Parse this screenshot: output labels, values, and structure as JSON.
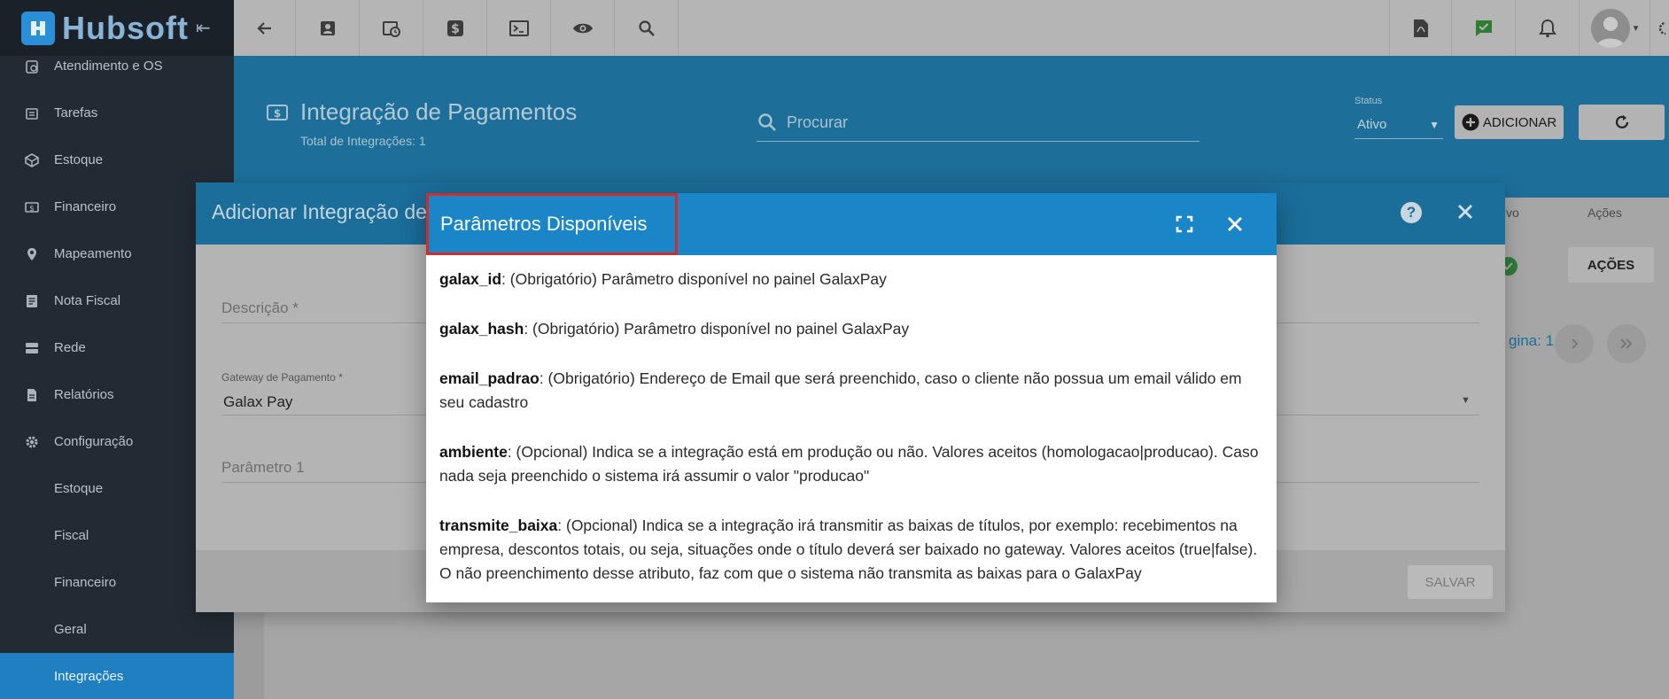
{
  "brand": {
    "name": "Hubsoft"
  },
  "sidebar": {
    "items": [
      {
        "label": "Atendimento e OS",
        "icon": "clipboard-icon"
      },
      {
        "label": "Tarefas",
        "icon": "tasks-icon"
      },
      {
        "label": "Estoque",
        "icon": "box-icon"
      },
      {
        "label": "Financeiro",
        "icon": "money-icon"
      },
      {
        "label": "Mapeamento",
        "icon": "map-pin-icon"
      },
      {
        "label": "Nota Fiscal",
        "icon": "receipt-icon"
      },
      {
        "label": "Rede",
        "icon": "server-icon"
      },
      {
        "label": "Relatórios",
        "icon": "report-icon"
      },
      {
        "label": "Configuração",
        "icon": "gear-icon"
      }
    ],
    "subitems": [
      "Estoque",
      "Fiscal",
      "Financeiro",
      "Geral",
      "Integrações"
    ],
    "active": "Integrações"
  },
  "header": {
    "title": "Integração de Pagamentos",
    "subtitle": "Total de Integrações: 1",
    "search_placeholder": "Procurar",
    "status_label": "Status",
    "status_value": "Ativo",
    "add_label": "ADICIONAR"
  },
  "table": {
    "col_ativo": "tivo",
    "col_acoes": "Ações",
    "row_action_label": "AÇÕES",
    "pager_text": "gina: 1"
  },
  "dialog": {
    "title": "Adicionar Integração de",
    "fields": {
      "descricao_placeholder": "Descrição *",
      "gateway_label": "Gateway de Pagamento *",
      "gateway_value": "Galax Pay",
      "param1_placeholder": "Parâmetro 1"
    },
    "save_label": "SALVAR"
  },
  "params_dialog": {
    "title": "Parâmetros Disponíveis",
    "params": [
      {
        "name": "galax_id",
        "desc": ": (Obrigatório) Parâmetro disponível no painel GalaxPay"
      },
      {
        "name": "galax_hash",
        "desc": ": (Obrigatório) Parâmetro disponível no painel GalaxPay"
      },
      {
        "name": "email_padrao",
        "desc": ": (Obrigatório) Endereço de Email que será preenchido, caso o cliente não possua um email válido em seu cadastro"
      },
      {
        "name": "ambiente",
        "desc": ": (Opcional) Indica se a integração está em produção ou não. Valores aceitos (homologacao|producao). Caso nada seja preenchido o sistema irá assumir o valor \"producao\""
      },
      {
        "name": "transmite_baixa",
        "desc": ": (Opcional) Indica se a integração irá transmitir as baixas de títulos, por exemplo: recebimentos na empresa, descontos totais, ou seja, situações onde o título deverá ser baixado no gateway. Valores aceitos (true|false). O não preenchimento desse atributo, faz com que o sistema não transmita as baixas para o GalaxPay"
      }
    ]
  },
  "colors": {
    "sidebar_bg": "#222a33",
    "active_item": "#1f7fc0",
    "dialog_header": "#1a86c8",
    "highlight_border": "#d42a2a"
  }
}
